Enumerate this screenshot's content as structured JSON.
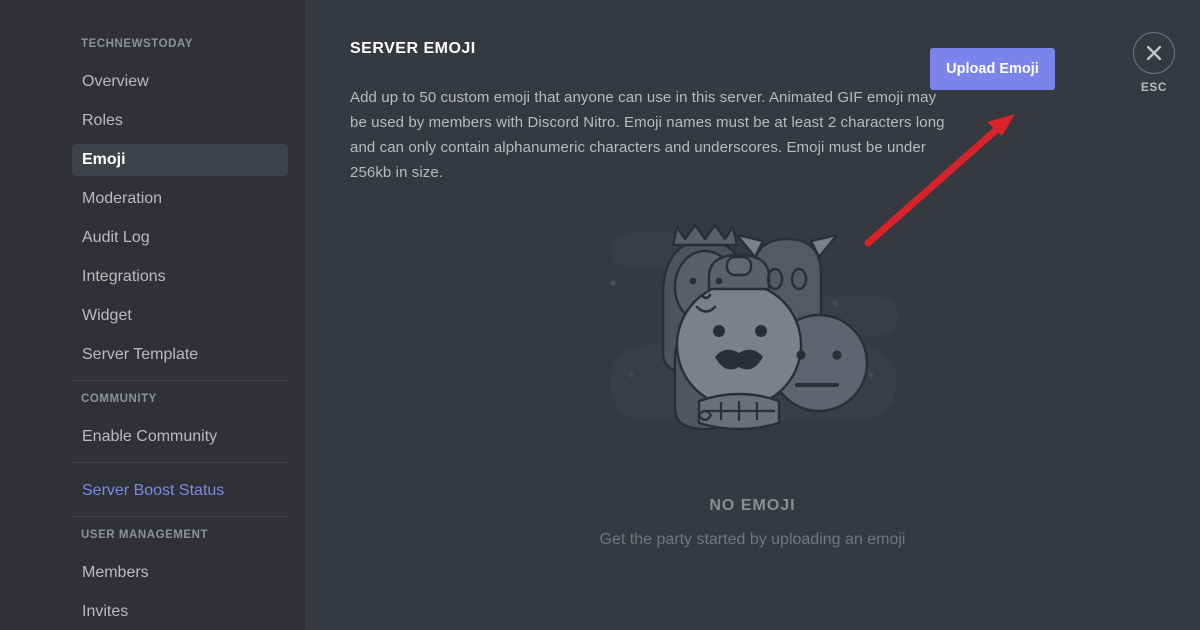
{
  "sidebar": {
    "server_name": "TECHNEWSTODAY",
    "server_items": [
      {
        "label": "Overview",
        "active": false
      },
      {
        "label": "Roles",
        "active": false
      },
      {
        "label": "Emoji",
        "active": true
      },
      {
        "label": "Moderation",
        "active": false
      },
      {
        "label": "Audit Log",
        "active": false
      },
      {
        "label": "Integrations",
        "active": false
      },
      {
        "label": "Widget",
        "active": false
      },
      {
        "label": "Server Template",
        "active": false
      }
    ],
    "community_header": "COMMUNITY",
    "community_items": [
      {
        "label": "Enable Community",
        "active": false
      }
    ],
    "boost_link": "Server Boost Status",
    "user_management_header": "USER MANAGEMENT",
    "user_management_items": [
      {
        "label": "Members",
        "active": false
      },
      {
        "label": "Invites",
        "active": false
      }
    ]
  },
  "main": {
    "title": "SERVER EMOJI",
    "description": "Add up to 50 custom emoji that anyone can use in this server. Animated GIF emoji may be used by members with Discord Nitro. Emoji names must be at least 2 characters long and can only contain alphanumeric characters and underscores. Emoji must be under 256kb in size.",
    "upload_button": "Upload Emoji",
    "empty_title": "NO EMOJI",
    "empty_subtitle": "Get the party started by uploading an emoji"
  },
  "close": {
    "icon": "close-x-icon",
    "label": "ESC"
  },
  "annotation": {
    "type": "arrow",
    "color": "#d8232a",
    "points_to": "Upload Emoji"
  },
  "colors": {
    "sidebar_bg": "#2f3136",
    "main_bg": "#36393f",
    "accent_blurple": "#7a84eb",
    "link": "#7f88e8",
    "text_muted": "#b9bbbe",
    "annotation_red": "#d8232a"
  }
}
